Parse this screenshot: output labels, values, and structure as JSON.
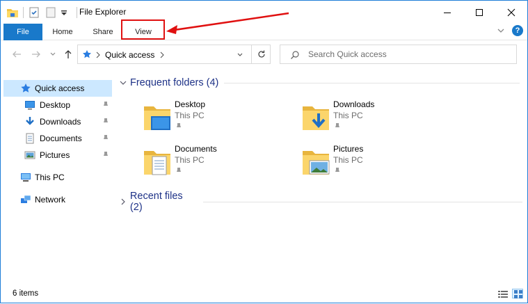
{
  "window": {
    "title": "File Explorer",
    "accent": "#1979ca"
  },
  "ribbon": {
    "tabs": [
      "File",
      "Home",
      "Share",
      "View"
    ],
    "highlighted_tab": "View",
    "annotation_color": "#e01010"
  },
  "navigation": {
    "address_location": "Quick access",
    "search_placeholder": "Search Quick access"
  },
  "sidebar": {
    "items": [
      {
        "label": "Quick access",
        "icon": "star-icon",
        "selected": true,
        "pinned": false
      },
      {
        "label": "Desktop",
        "icon": "desktop-icon",
        "selected": false,
        "pinned": true
      },
      {
        "label": "Downloads",
        "icon": "download-icon",
        "selected": false,
        "pinned": true
      },
      {
        "label": "Documents",
        "icon": "documents-icon",
        "selected": false,
        "pinned": true
      },
      {
        "label": "Pictures",
        "icon": "pictures-icon",
        "selected": false,
        "pinned": true
      },
      {
        "label": "This PC",
        "icon": "computer-icon",
        "selected": false,
        "pinned": false
      },
      {
        "label": "Network",
        "icon": "network-icon",
        "selected": false,
        "pinned": false
      }
    ]
  },
  "main": {
    "frequent_header": "Frequent folders (4)",
    "recent_header": "Recent files (2)",
    "folders": [
      {
        "name": "Desktop",
        "location": "This PC",
        "icon": "desktop-folder-icon"
      },
      {
        "name": "Downloads",
        "location": "This PC",
        "icon": "downloads-folder-icon"
      },
      {
        "name": "Documents",
        "location": "This PC",
        "icon": "documents-folder-icon"
      },
      {
        "name": "Pictures",
        "location": "This PC",
        "icon": "pictures-folder-icon"
      }
    ]
  },
  "status": {
    "item_count": "6 items"
  }
}
